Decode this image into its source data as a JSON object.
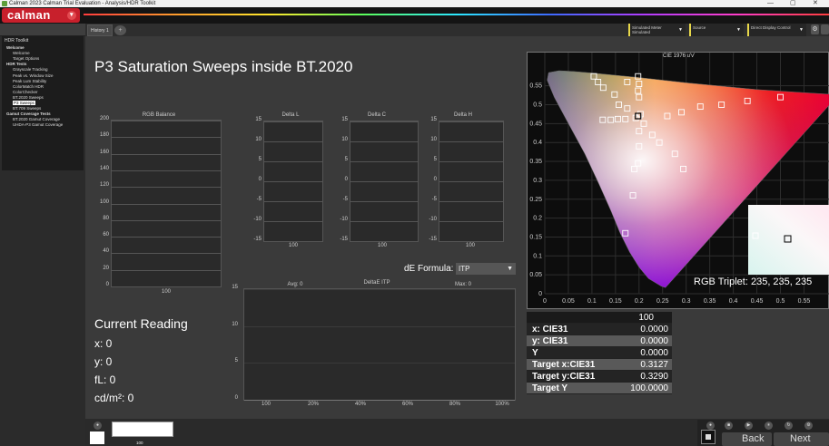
{
  "window": {
    "title": "Calman 2023 Calman Trial Evaluation - Analysis/HDR Toolkit",
    "controls": [
      "—",
      "▢",
      "✕"
    ]
  },
  "app": {
    "logo": "calman",
    "menu_arrow": "▾"
  },
  "sidebar": {
    "title": "HDR Toolkit",
    "items": [
      {
        "label": "Welcome",
        "bold": true
      },
      {
        "label": "Welcome",
        "bold": false
      },
      {
        "label": "Target Options",
        "bold": false
      },
      {
        "label": "HDR Tests",
        "bold": true
      },
      {
        "label": "Grayscale Tracking",
        "bold": false
      },
      {
        "label": "Peak vs. Window Size",
        "bold": false
      },
      {
        "label": "Peak Lum Stability",
        "bold": false
      },
      {
        "label": "ColorMatch HDR",
        "bold": false
      },
      {
        "label": "ColorChecker",
        "bold": false
      },
      {
        "label": "BT.2020 Sweeps",
        "bold": false
      },
      {
        "label": "P3 Sweeps",
        "bold": false,
        "selected": true
      },
      {
        "label": "BT.709 Sweeps",
        "bold": false
      },
      {
        "label": "Gamut Coverage Tests",
        "bold": true
      },
      {
        "label": "BT.2020 Gamut Coverage",
        "bold": false
      },
      {
        "label": "UHDA-P3 Gamut Coverage",
        "bold": false
      }
    ]
  },
  "tabs": {
    "active": "History 1",
    "add": "+"
  },
  "toolbar": {
    "meter": {
      "line1": "Simulated Meter",
      "line2": "Simulated"
    },
    "source": {
      "line1": "Source",
      "line2": ""
    },
    "display": {
      "line1": "Direct Display Control",
      "line2": ""
    },
    "icon": "⚙"
  },
  "page": {
    "title": "P3 Saturation Sweeps inside BT.2020"
  },
  "rgb_balance": {
    "title": "RGB Balance",
    "ticks": [
      "200",
      "180",
      "160",
      "140",
      "120",
      "100",
      "80",
      "60",
      "40",
      "20",
      "0"
    ],
    "xlabel": "100"
  },
  "delta_l": {
    "title": "Delta L",
    "ticks": [
      "15",
      "10",
      "5",
      "0",
      "-5",
      "-10",
      "-15"
    ],
    "xlabel": "100"
  },
  "delta_c": {
    "title": "Delta C",
    "ticks": [
      "15",
      "10",
      "5",
      "0",
      "-5",
      "-10",
      "-15"
    ],
    "xlabel": "100"
  },
  "delta_h": {
    "title": "Delta H",
    "ticks": [
      "15",
      "10",
      "5",
      "0",
      "-5",
      "-10",
      "-15"
    ],
    "xlabel": "100"
  },
  "de_formula": {
    "label": "dE Formula:",
    "value": "ITP"
  },
  "deltae_chart": {
    "title": "DeltaE ITP",
    "avg": "Avg: 0",
    "max": "Max: 0",
    "yticks": [
      "15",
      "10",
      "5",
      "0"
    ],
    "xticks": [
      "100",
      "20%",
      "40%",
      "60%",
      "80%",
      "100%"
    ]
  },
  "current_reading": {
    "title": "Current Reading",
    "x": "x: 0",
    "y": "y: 0",
    "fl": "fL: 0",
    "cdm2": "cd/m²: 0"
  },
  "cie": {
    "title": "CIE 1976 u'v'",
    "yticks": [
      "0.55",
      "0.5",
      "0.45",
      "0.4",
      "0.35",
      "0.3",
      "0.25",
      "0.2",
      "0.15",
      "0.1",
      "0.05",
      "0"
    ],
    "xticks": [
      "0",
      "0.05",
      "0.1",
      "0.15",
      "0.2",
      "0.25",
      "0.3",
      "0.35",
      "0.4",
      "0.45",
      "0.5",
      "0.55"
    ],
    "rgb_triplet": "RGB Triplet: 235, 235, 235"
  },
  "chart_data": {
    "type": "scatter",
    "title": "CIE 1976 u'v'",
    "xlim": [
      0,
      0.6
    ],
    "ylim": [
      0,
      0.6
    ],
    "series": [
      {
        "values": [
          [
            0.104,
            0.575
          ],
          [
            0.113,
            0.56
          ],
          [
            0.124,
            0.545
          ],
          [
            0.148,
            0.527
          ],
          [
            0.157,
            0.5
          ],
          [
            0.175,
            0.56
          ],
          [
            0.198,
            0.575
          ],
          [
            0.2,
            0.555
          ],
          [
            0.198,
            0.537
          ],
          [
            0.2,
            0.52
          ],
          [
            0.175,
            0.49
          ],
          [
            0.2,
            0.47
          ],
          [
            0.2,
            0.43
          ],
          [
            0.2,
            0.39
          ],
          [
            0.198,
            0.345
          ],
          [
            0.19,
            0.33
          ],
          [
            0.187,
            0.26
          ],
          [
            0.171,
            0.16
          ],
          [
            0.123,
            0.46
          ],
          [
            0.14,
            0.46
          ],
          [
            0.155,
            0.462
          ],
          [
            0.171,
            0.462
          ],
          [
            0.193,
            0.465
          ],
          [
            0.203,
            0.475
          ],
          [
            0.21,
            0.45
          ],
          [
            0.228,
            0.42
          ],
          [
            0.243,
            0.4
          ],
          [
            0.26,
            0.47
          ],
          [
            0.276,
            0.37
          ],
          [
            0.294,
            0.33
          ],
          [
            0.29,
            0.48
          ],
          [
            0.33,
            0.495
          ],
          [
            0.375,
            0.5
          ],
          [
            0.43,
            0.51
          ],
          [
            0.5,
            0.52
          ]
        ]
      }
    ],
    "current_point": [
      0.198,
      0.47
    ]
  },
  "reading_table": {
    "header": "100",
    "rows": [
      {
        "key": "x: CIE31",
        "value": "0.0000"
      },
      {
        "key": "y: CIE31",
        "value": "0.0000"
      },
      {
        "key": "Y",
        "value": "0.0000"
      },
      {
        "key": "Target x:CIE31",
        "value": "0.3127"
      },
      {
        "key": "Target y:CIE31",
        "value": "0.3290"
      },
      {
        "key": "Target Y",
        "value": "100.0000"
      }
    ]
  },
  "bottom": {
    "swatch_label": "100",
    "back": "Back",
    "next": "Next"
  }
}
